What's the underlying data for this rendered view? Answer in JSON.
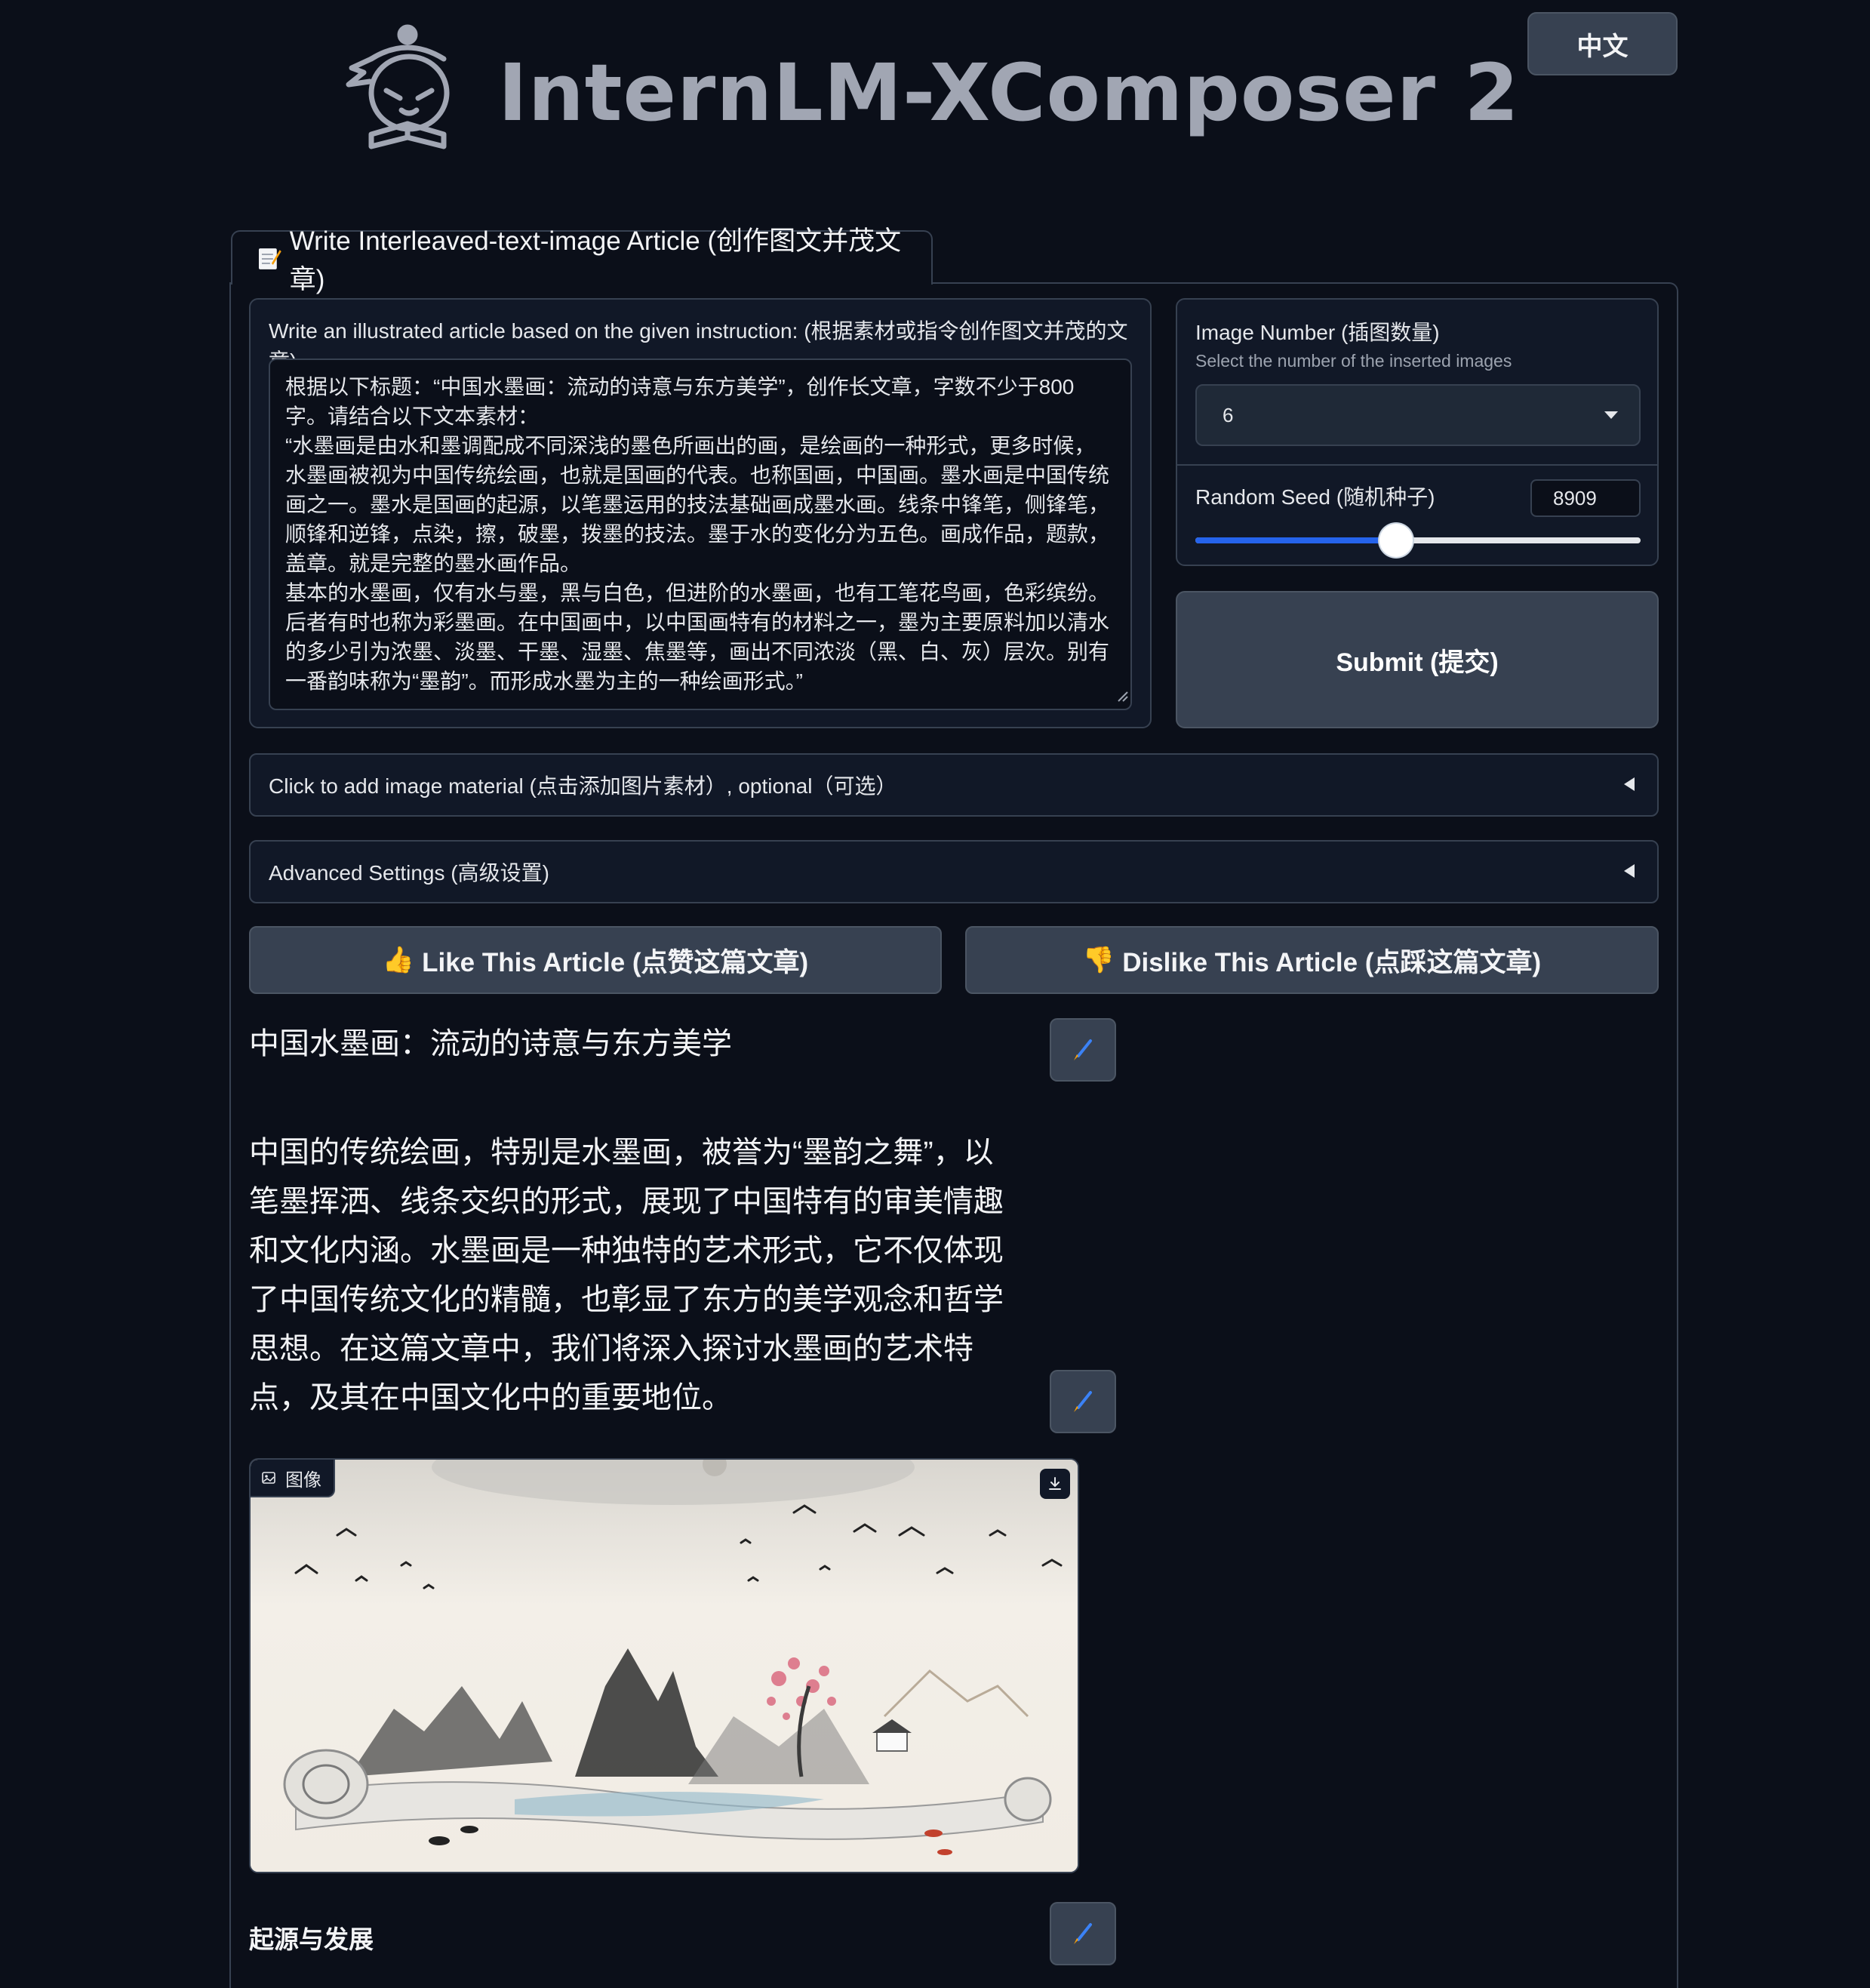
{
  "header": {
    "app_title": "InternLM-XComposer 2",
    "language_button": "中文"
  },
  "tab": {
    "label": "Write Interleaved-text-image Article (创作图文并茂文章)",
    "icon": "memo-icon"
  },
  "instruction": {
    "label": "Write an illustrated article based on the given instruction: (根据素材或指令创作图文并茂的文章)",
    "value": "根据以下标题：“中国水墨画：流动的诗意与东方美学”，创作长文章，字数不少于800\n字。请结合以下文本素材：\n“水墨画是由水和墨调配成不同深浅的墨色所画出的画，是绘画的一种形式，更多时候，\n水墨画被视为中国传统绘画，也就是国画的代表。也称国画，中国画。墨水画是中国传统\n画之一。墨水是国画的起源，以笔墨运用的技法基础画成墨水画。线条中锋笔，侧锋笔，\n顺锋和逆锋，点染，擦，破墨，拨墨的技法。墨于水的变化分为五色。画成作品，题款，\n盖章。就是完整的墨水画作品。\n基本的水墨画，仅有水与墨，黑与白色，但进阶的水墨画，也有工笔花鸟画，色彩缤纷。\n后者有时也称为彩墨画。在中国画中，以中国画特有的材料之一，墨为主要原料加以清水\n的多少引为浓墨、淡墨、干墨、湿墨、焦墨等，画出不同浓淡（黑、白、灰）层次。别有\n一番韵味称为“墨韵”。而形成水墨为主的一种绘画形式。”"
  },
  "settings": {
    "image_number": {
      "label": "Image Number (插图数量)",
      "info": "Select the number of the inserted images",
      "value": "6"
    },
    "random_seed": {
      "label": "Random Seed (随机种子)",
      "value": "8909",
      "slider_fraction": 0.45
    }
  },
  "submit_label": "Submit (提交)",
  "accordions": {
    "image_material": "Click to add image material (点击添加图片素材）, optional（可选）",
    "advanced": "Advanced Settings (高级设置)"
  },
  "vote": {
    "like": "Like This Article (点赞这篇文章)",
    "like_icon": "👍",
    "dislike": "Dislike This Article (点踩这篇文章)",
    "dislike_icon": "👎"
  },
  "article": {
    "title": "中国水墨画：流动的诗意与东方美学",
    "paragraph": "中国的传统绘画，特别是水墨画，被誉为“墨韵之舞”，以笔墨挥洒、线条交织的形式，展现了中国特有的审美情趣和文化内涵。水墨画是一种独特的艺术形式，它不仅体现了中国传统文化的精髓，也彰显了东方的美学观念和哲学思想。在这篇文章中，我们将深入探讨水墨画的艺术特点，及其在中国文化中的重要地位。",
    "image_label": "图像",
    "section_title": "起源与发展"
  },
  "colors": {
    "background": "#0b0f19",
    "panel": "#111827",
    "border": "#374151",
    "button": "#374151",
    "accent": "#2563eb"
  }
}
